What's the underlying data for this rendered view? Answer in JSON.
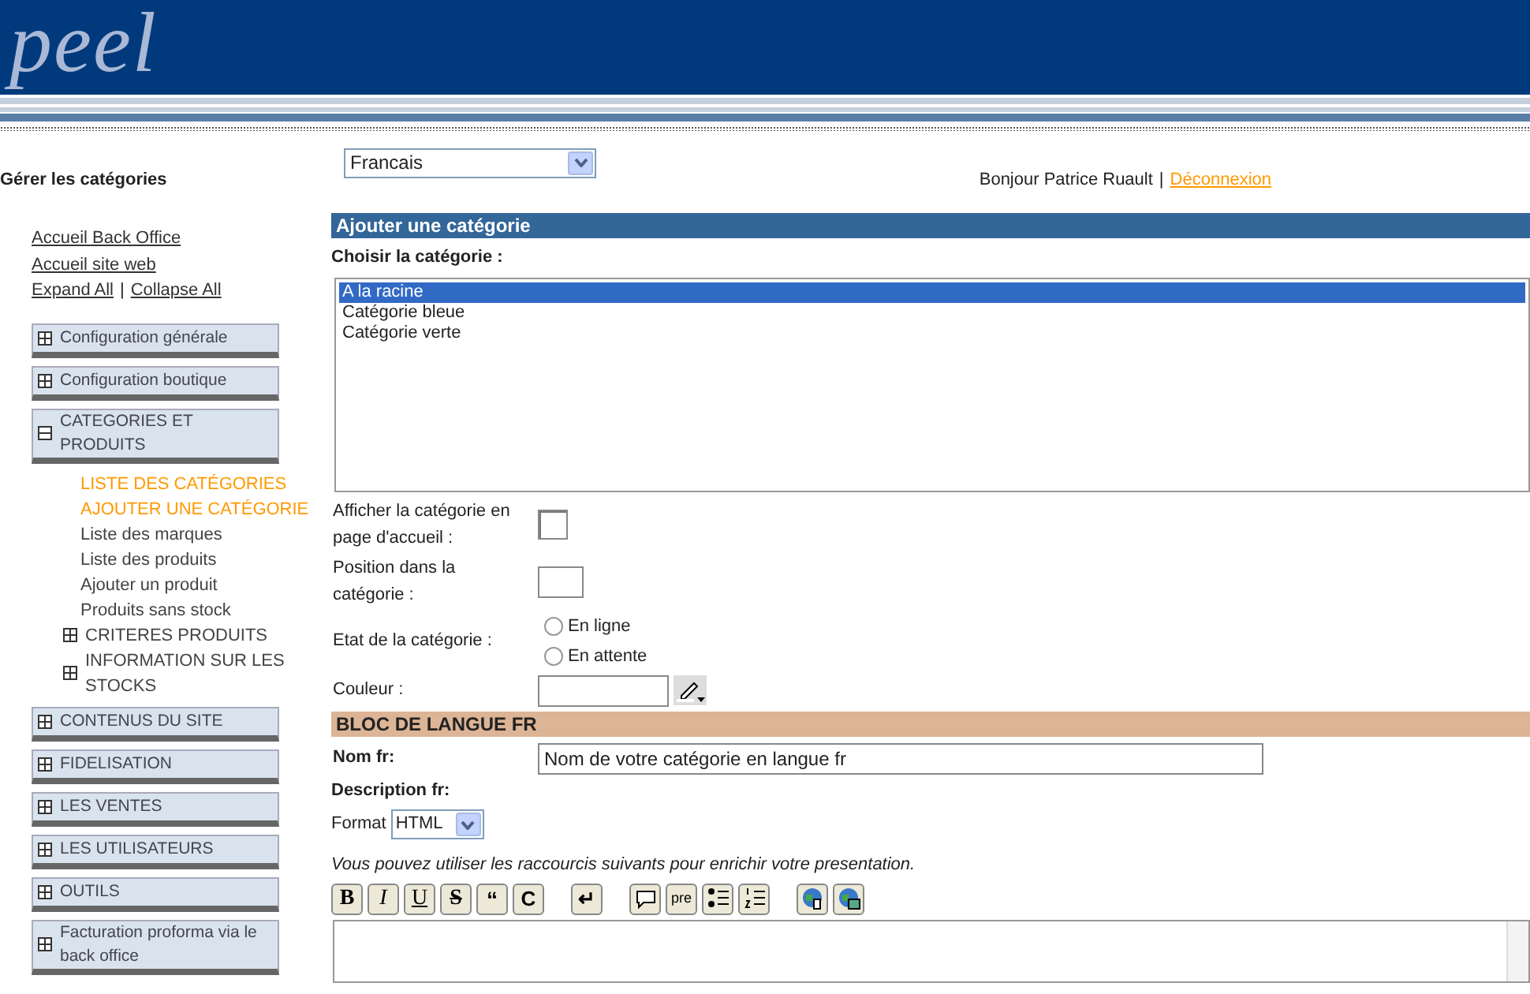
{
  "header": {
    "logo": "peel"
  },
  "page_title": "Gérer les catégories",
  "language_select": {
    "value": "Francais"
  },
  "user_bar": {
    "greeting": "Bonjour Patrice Ruault",
    "separator": "|",
    "logout": "Déconnexion"
  },
  "sidebar": {
    "links": [
      "Accueil Back Office",
      "Accueil site web"
    ],
    "expand_all": "Expand All",
    "separator": "|",
    "collapse_all": "Collapse All",
    "menus": [
      {
        "label": "Configuration générale",
        "expanded": false
      },
      {
        "label": "Configuration boutique",
        "expanded": false
      },
      {
        "label": "CATEGORIES ET PRODUITS",
        "expanded": true,
        "children": [
          {
            "kind": "link",
            "label": "LISTE DES CATÉGORIES",
            "highlighted": true
          },
          {
            "kind": "link",
            "label": "AJOUTER UNE CATÉGORIE",
            "highlighted": true
          },
          {
            "kind": "link",
            "label": "Liste des marques",
            "highlighted": false
          },
          {
            "kind": "link",
            "label": "Liste des produits",
            "highlighted": false
          },
          {
            "kind": "link",
            "label": "Ajouter un produit",
            "highlighted": false
          },
          {
            "kind": "link",
            "label": "Produits sans stock",
            "highlighted": false
          },
          {
            "kind": "group",
            "label": "CRITERES PRODUITS",
            "highlighted": false,
            "expanded": false
          },
          {
            "kind": "group",
            "label": "INFORMATION SUR LES STOCKS",
            "highlighted": false,
            "expanded": false
          }
        ]
      },
      {
        "label": "CONTENUS DU SITE",
        "expanded": false
      },
      {
        "label": "FIDELISATION",
        "expanded": false
      },
      {
        "label": "LES VENTES",
        "expanded": false
      },
      {
        "label": "LES UTILISATEURS",
        "expanded": false
      },
      {
        "label": "OUTILS",
        "expanded": false
      },
      {
        "label": "Facturation proforma via le back office",
        "expanded": false
      }
    ]
  },
  "form": {
    "title": "Ajouter une catégorie",
    "category_label": "Choisir la catégorie :",
    "category_options": [
      {
        "label": "A la racine",
        "selected": true
      },
      {
        "label": "Catégorie bleue",
        "selected": false
      },
      {
        "label": "Catégorie verte",
        "selected": false
      }
    ],
    "fields": [
      {
        "kind": "checkbox",
        "label": "Afficher la catégorie en page d'accueil :",
        "checked": false
      },
      {
        "kind": "text",
        "label": "Position dans la catégorie :"
      },
      {
        "kind": "radio",
        "label": "Etat de la catégorie :",
        "options": [
          {
            "label": "En ligne",
            "selected": false
          },
          {
            "label": "En attente",
            "selected": false
          }
        ]
      },
      {
        "kind": "color",
        "label": "Couleur :"
      }
    ]
  },
  "language_block": {
    "title": "BLOC DE LANGUE FR",
    "name_label": "Nom fr:",
    "name_value": "Nom de votre catégorie en langue fr",
    "description_label": "Description fr:",
    "format_label": "Format",
    "format_value": "HTML",
    "hint": "Vous pouvez utiliser les raccourcis suivants pour enrichir votre presentation.",
    "toolbar": [
      [
        {
          "kind": "bold",
          "label": "B"
        },
        {
          "kind": "italic",
          "label": "I"
        },
        {
          "kind": "underline",
          "label": "U"
        },
        {
          "kind": "strike",
          "label": "S"
        },
        {
          "kind": "quote",
          "label": "“"
        },
        {
          "kind": "clear",
          "label": "C"
        }
      ],
      [
        {
          "kind": "newline",
          "label": "↵"
        }
      ],
      [
        {
          "kind": "comment"
        },
        {
          "kind": "pre",
          "label": "pre"
        },
        {
          "kind": "bullets"
        },
        {
          "kind": "numbers"
        }
      ],
      [
        {
          "kind": "link"
        },
        {
          "kind": "image"
        }
      ]
    ]
  }
}
